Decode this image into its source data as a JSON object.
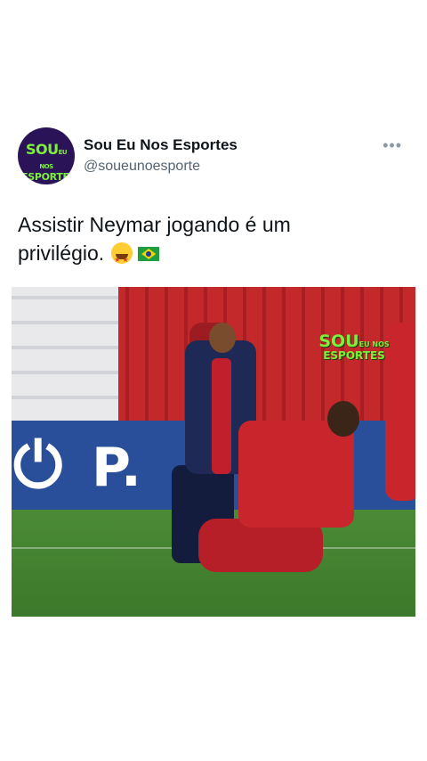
{
  "tweet": {
    "display_name": "Sou Eu Nos Esportes",
    "handle": "@soueunoesporte",
    "more_icon": "more-icon",
    "text_line1": "Assistir Neymar jogando é um",
    "text_line2": "privilégio.",
    "emojis": [
      "star-struck-emoji",
      "brazil-flag-emoji"
    ]
  },
  "avatar": {
    "logo_line1": "SOU",
    "logo_small": "EU NOS",
    "logo_line2": "ESPORTES"
  },
  "media": {
    "watermark_line1": "SOU",
    "watermark_small": "EU NOS",
    "watermark_line2": "ESPORTES",
    "board_text": "P.",
    "colors": {
      "stands": "#c3282a",
      "board": "#2a4f9a",
      "pitch": "#3f7d2e",
      "brand_green": "#7cf03a",
      "avatar_bg": "#2a1457"
    }
  }
}
